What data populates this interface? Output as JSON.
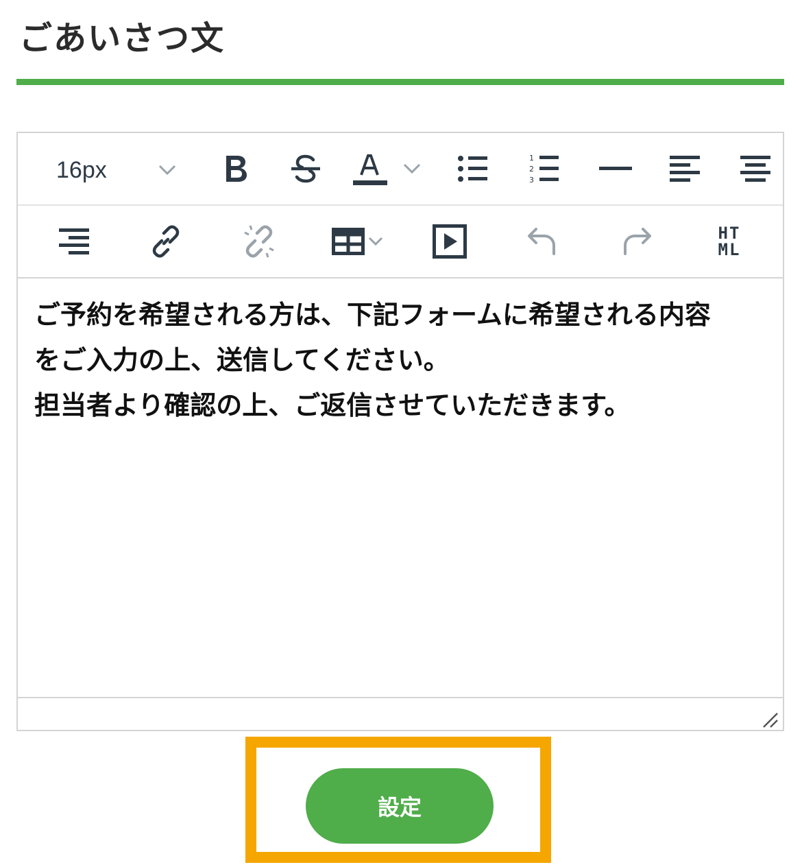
{
  "header": {
    "title": "ごあいさつ文"
  },
  "colors": {
    "accent": "#4fad4a",
    "highlight": "#f5a600",
    "icon": "#2d3a45",
    "icon_disabled": "#9aa3aa"
  },
  "toolbar": {
    "font_size_value": "16px",
    "row1_icons": [
      "font-size-select",
      "bold-icon",
      "strikethrough-icon",
      "text-color-icon",
      "bullet-list-icon",
      "numbered-list-icon",
      "horizontal-rule-icon",
      "align-left-icon",
      "align-center-icon"
    ],
    "row2_icons": [
      "align-right-icon",
      "link-icon",
      "unlink-icon",
      "table-icon",
      "video-icon",
      "undo-icon",
      "redo-icon",
      "html-icon"
    ],
    "html_label_top": "HT",
    "html_label_bottom": "ML"
  },
  "editor": {
    "lines": [
      "ご予約を希望される方は、下記フォームに希望される内容",
      "をご入力の上、送信してください。",
      "担当者より確認の上、ご返信させていただきます。"
    ]
  },
  "actions": {
    "save_label": "設定"
  }
}
